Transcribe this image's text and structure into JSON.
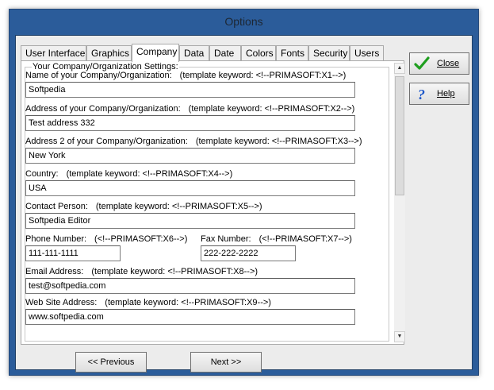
{
  "window": {
    "title": "Options"
  },
  "tabs": [
    {
      "label": "User Interface"
    },
    {
      "label": "Graphics"
    },
    {
      "label": "Company"
    },
    {
      "label": "Data"
    },
    {
      "label": "Date"
    },
    {
      "label": "Colors"
    },
    {
      "label": "Fonts"
    },
    {
      "label": "Security"
    },
    {
      "label": "Users"
    }
  ],
  "active_tab": "Company",
  "group": {
    "title": "Your Company/Organization Settings:"
  },
  "fields": {
    "name": {
      "label": "Name of your Company/Organization:",
      "keyword": "(template keyword: <!--PRIMASOFT:X1-->)",
      "value": "Softpedia"
    },
    "address": {
      "label": "Address of your Company/Organization:",
      "keyword": "(template keyword: <!--PRIMASOFT:X2-->)",
      "value": "Test address 332"
    },
    "address2": {
      "label": "Address 2 of your Company/Organization:",
      "keyword": "(template keyword: <!--PRIMASOFT:X3-->)",
      "value": "New York"
    },
    "country": {
      "label": "Country:",
      "keyword": "(template keyword: <!--PRIMASOFT:X4-->)",
      "value": "USA"
    },
    "contact": {
      "label": "Contact Person:",
      "keyword": "(template keyword: <!--PRIMASOFT:X5-->)",
      "value": "Softpedia Editor"
    },
    "phone": {
      "label": "Phone Number:",
      "keyword": "(<!--PRIMASOFT:X6-->)",
      "value": "111-111-1111"
    },
    "fax": {
      "label": "Fax Number:",
      "keyword": "(<!--PRIMASOFT:X7-->)",
      "value": "222-222-2222"
    },
    "email": {
      "label": "Email Address:",
      "keyword": "(template keyword: <!--PRIMASOFT:X8-->)",
      "value": "test@softpedia.com"
    },
    "website": {
      "label": "Web Site Address:",
      "keyword": "(template keyword: <!--PRIMASOFT:X9-->)",
      "value": "www.softpedia.com"
    }
  },
  "buttons": {
    "close": {
      "label": "Close",
      "icon": "checkmark-icon"
    },
    "help": {
      "label": "Help",
      "icon": "question-mark-icon"
    },
    "previous": "<< Previous",
    "next": "Next >>"
  },
  "colors": {
    "window_frame": "#2b5c9a",
    "check": "#1e9e1e",
    "help": "#1a55c8"
  }
}
